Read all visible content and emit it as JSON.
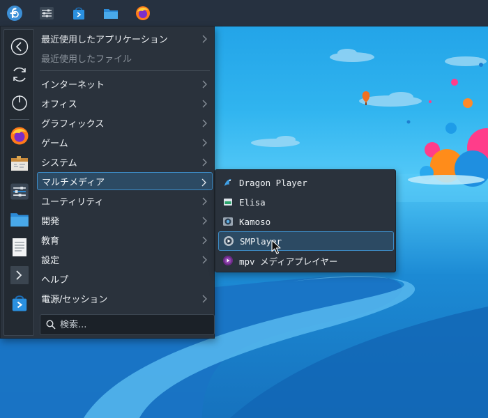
{
  "taskbar": {
    "items": [
      {
        "name": "application-launcher",
        "icon": "fedora-logo-icon"
      },
      {
        "name": "system-settings",
        "icon": "settings-sliders-icon"
      },
      {
        "name": "discover",
        "icon": "software-store-icon"
      },
      {
        "name": "file-manager",
        "icon": "folder-icon"
      },
      {
        "name": "firefox",
        "icon": "firefox-icon"
      }
    ]
  },
  "launcher": {
    "sidebar_icons": [
      "back-arrow-icon",
      "restart-icon",
      "power-icon",
      "firefox-icon",
      "archive-icon",
      "settings-sliders-icon",
      "folder-icon",
      "text-document-icon",
      "terminal-icon",
      "software-store-icon"
    ],
    "categories": [
      {
        "label": "最近使用したアプリケーション",
        "has_submenu": true
      },
      {
        "label": "最近使用したファイル",
        "has_submenu": false,
        "disabled": true
      },
      {
        "label": "インターネット",
        "has_submenu": true
      },
      {
        "label": "オフィス",
        "has_submenu": true
      },
      {
        "label": "グラフィックス",
        "has_submenu": true
      },
      {
        "label": "ゲーム",
        "has_submenu": true
      },
      {
        "label": "システム",
        "has_submenu": true
      },
      {
        "label": "マルチメディア",
        "has_submenu": true,
        "selected": true
      },
      {
        "label": "ユーティリティ",
        "has_submenu": true
      },
      {
        "label": "開発",
        "has_submenu": true
      },
      {
        "label": "教育",
        "has_submenu": true
      },
      {
        "label": "設定",
        "has_submenu": true
      },
      {
        "label": "ヘルプ",
        "has_submenu": false
      },
      {
        "label": "電源/セッション",
        "has_submenu": true
      }
    ],
    "search_placeholder": "検索..."
  },
  "multimedia_submenu": {
    "items": [
      {
        "label": "Dragon Player",
        "icon": "dragon-player-icon"
      },
      {
        "label": "Elisa",
        "icon": "elisa-icon"
      },
      {
        "label": "Kamoso",
        "icon": "kamoso-icon"
      },
      {
        "label": "SMPlayer",
        "icon": "smplayer-icon",
        "selected": true
      },
      {
        "label": "mpv メディアプレイヤー",
        "icon": "mpv-icon"
      }
    ]
  },
  "colors": {
    "panel": "#263140",
    "menu_bg": "#2a323c",
    "highlight_border": "#3d8cc7",
    "highlight_bg": "#2c4a63"
  }
}
